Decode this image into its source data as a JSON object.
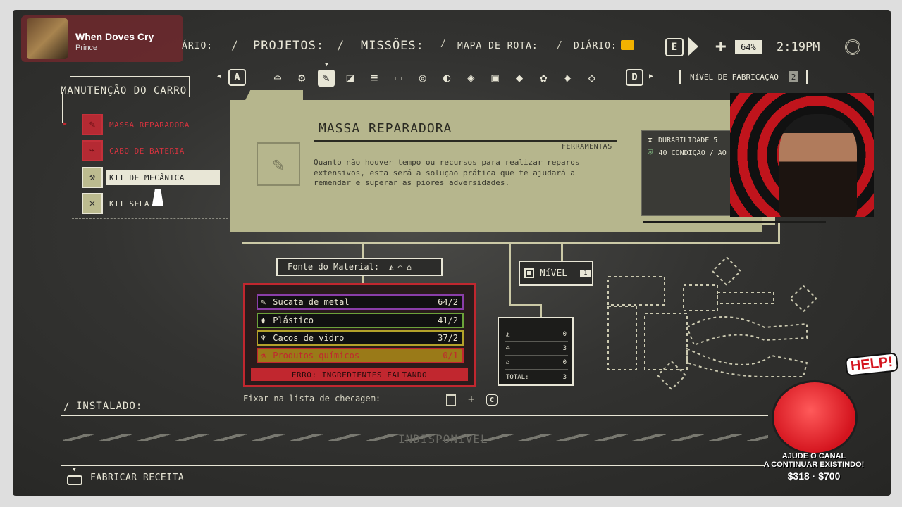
{
  "now_playing": {
    "title": "When Doves Cry",
    "artist": "Prince"
  },
  "top_nav": {
    "cut_tab": "ÁRIO:",
    "tabs": [
      "PROJETOS:",
      "MISSÕES:",
      "MAPA DE ROTA:",
      "DIÁRIO:"
    ],
    "key_left": "E",
    "zoom": "64%",
    "time": "2:19PM"
  },
  "category_bar": {
    "key_left": "A",
    "key_right": "D",
    "fab_level_label": "NíVEL DE FABRICAÇÃO",
    "fab_level_value": "2",
    "icons": [
      "car-body-icon",
      "gears-icon",
      "tool-icon",
      "seat-icon",
      "ramp-icon",
      "battery-tray-icon",
      "tire-icon",
      "headlight-icon",
      "box-icon",
      "battery-icon",
      "engine-icon",
      "plant-icon",
      "settings-gear-icon",
      "diamond-icon"
    ],
    "active_index": 2
  },
  "sidebar": {
    "title": "MANUTENÇÃO DO CARRO",
    "items": [
      {
        "label": "MASSA REPARADORA",
        "state": "unavailable",
        "icon": "putty-icon"
      },
      {
        "label": "CABO DE BATERIA",
        "state": "unavailable",
        "icon": "cable-icon"
      },
      {
        "label": "KIT DE MECÂNICA",
        "state": "selected",
        "icon": "mechanic-kit-icon"
      },
      {
        "label": "KIT SELA",
        "state": "normal",
        "icon": "sealant-kit-icon"
      }
    ]
  },
  "detail": {
    "title": "MASSA REPARADORA",
    "category": "FERRAMENTAS",
    "description": "Quanto não houver tempo ou recursos para realizar reparos extensivos, esta será a solução prática que te ajudará a remendar e superar as piores adversidades.",
    "stats": [
      {
        "icon": "hourglass-icon",
        "text": "DURABILIDADE  5"
      },
      {
        "icon": "shield-icon",
        "text": "40 CONDIÇÃO / AO"
      }
    ]
  },
  "material": {
    "source_label": "Fonte do Material:",
    "rows": [
      {
        "name": "Sucata de metal",
        "qty": "64/2",
        "color": "#8a3ea8",
        "icon": "scrap-icon"
      },
      {
        "name": "Plástico",
        "qty": "41/2",
        "color": "#6ca23a",
        "icon": "bottle-icon"
      },
      {
        "name": "Cacos de vidro",
        "qty": "37/2",
        "color": "#b3a12a",
        "icon": "glass-icon"
      },
      {
        "name": "Produtos químicos",
        "qty": "0/1",
        "color": "#c1272f",
        "icon": "chemical-icon"
      }
    ],
    "error": "ERRO: INGREDIENTES FALTANDO"
  },
  "level": {
    "label": "NíVEL",
    "value": "1"
  },
  "totals": {
    "rows": [
      {
        "icon": "bag-icon",
        "value": "0"
      },
      {
        "icon": "car-icon",
        "value": "3"
      },
      {
        "icon": "house-icon",
        "value": "0"
      }
    ],
    "total_label": "TOTAL:",
    "total_value": "3"
  },
  "fixar_label": "Fixar na lista de checagem:",
  "fixar_key": "C",
  "installed_label": "INSTALADO:",
  "unavailable_label": "INDISPONíVEL",
  "fabricar_label": "FABRICAR RECEITA",
  "donation": {
    "help": "HELP!",
    "line1": "AJUDE O CANAL",
    "line2": "A CONTINUAR EXISTINDO!",
    "amount": "$318 · $700"
  },
  "colors": {
    "panel": "#b6b68d",
    "error": "#c1272f",
    "cream": "#e8e6d6"
  }
}
